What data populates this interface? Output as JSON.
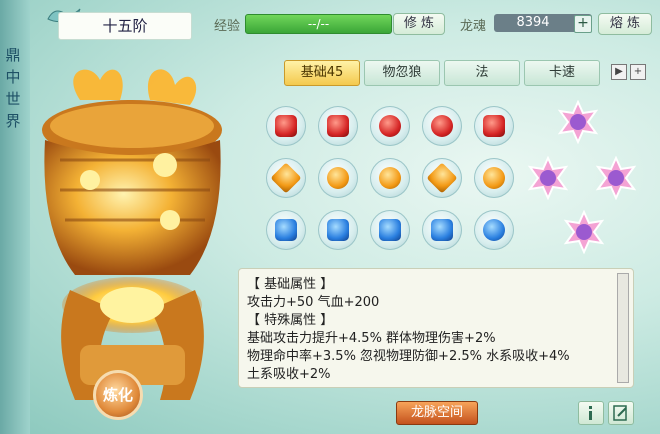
{
  "side_title": [
    "鼎",
    "中",
    "世",
    "界"
  ],
  "level": "十五阶",
  "exp": {
    "label": "经验",
    "value": "--/--"
  },
  "cultivate_button": "修 炼",
  "soul": {
    "label": "龙魂",
    "value": "8394"
  },
  "smelt_button": "熔 炼",
  "tabs": [
    "基础45",
    "物忽狼",
    "法",
    "卡速"
  ],
  "attributes": {
    "basic_header": "【 基础属性 】",
    "basic_line": "攻击力+50 气血+200",
    "special_header": "【 特殊属性 】",
    "special_lines": [
      "基础攻击力提升+4.5% 群体物理伤害+2%",
      "物理命中率+3.5% 忽视物理防御+2.5% 水系吸收+4%",
      "土系吸收+2%"
    ]
  },
  "dragon_space_button": "龙脉空间",
  "refine_button": "炼化",
  "gems": {
    "rows": [
      "red",
      "orange",
      "blue"
    ],
    "count_per_row": 5
  },
  "colors": {
    "gold": "#f4c94d",
    "exp_green": "#3aa638",
    "orange_btn": "#c4521d"
  },
  "icons": [
    "info-icon",
    "edit-icon",
    "plus-icon",
    "arrow-right-icon"
  ]
}
